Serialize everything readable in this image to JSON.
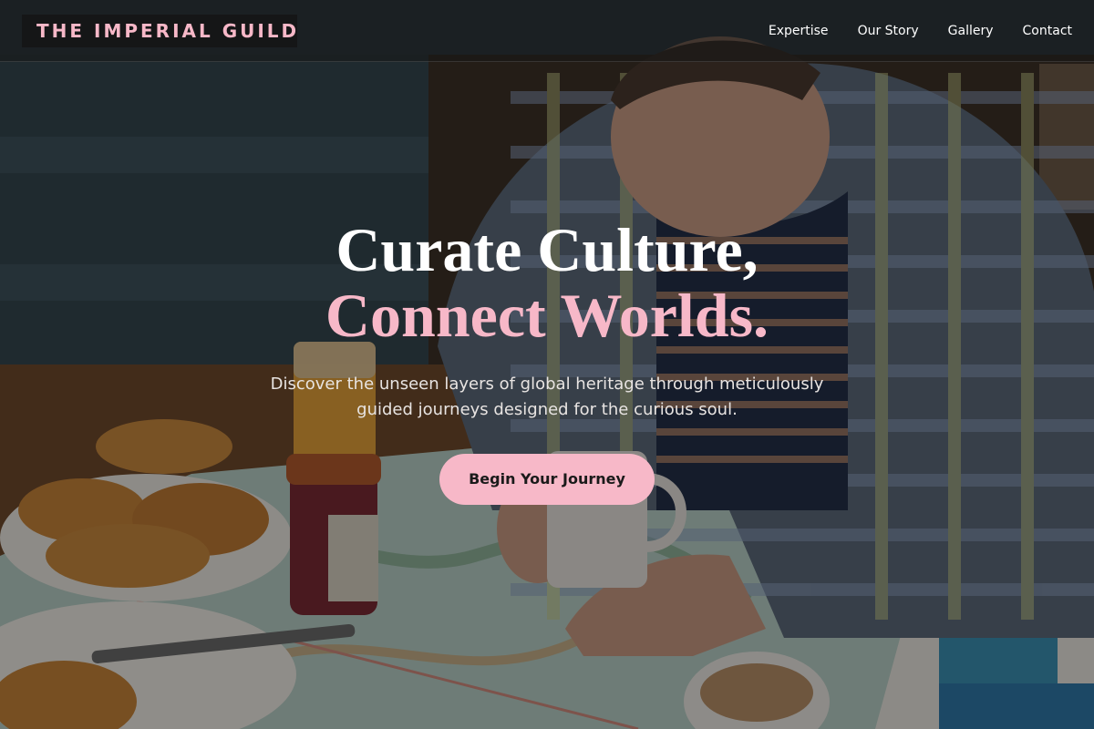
{
  "brand": {
    "logo_text": "THE IMPERIAL GUILD"
  },
  "nav": {
    "items": [
      {
        "label": "Expertise"
      },
      {
        "label": "Our Story"
      },
      {
        "label": "Gallery"
      },
      {
        "label": "Contact"
      }
    ]
  },
  "hero": {
    "headline_line1": "Curate Culture,",
    "headline_line2": "Connect Worlds.",
    "subtitle": "Discover the unseen layers of global heritage through meticulously guided journeys designed for the curious soul.",
    "cta_label": "Begin Your Journey"
  },
  "colors": {
    "accent_pink": "#f7b8c8",
    "overlay": "rgba(0,0,0,0.40)",
    "text_white": "#ffffff"
  }
}
